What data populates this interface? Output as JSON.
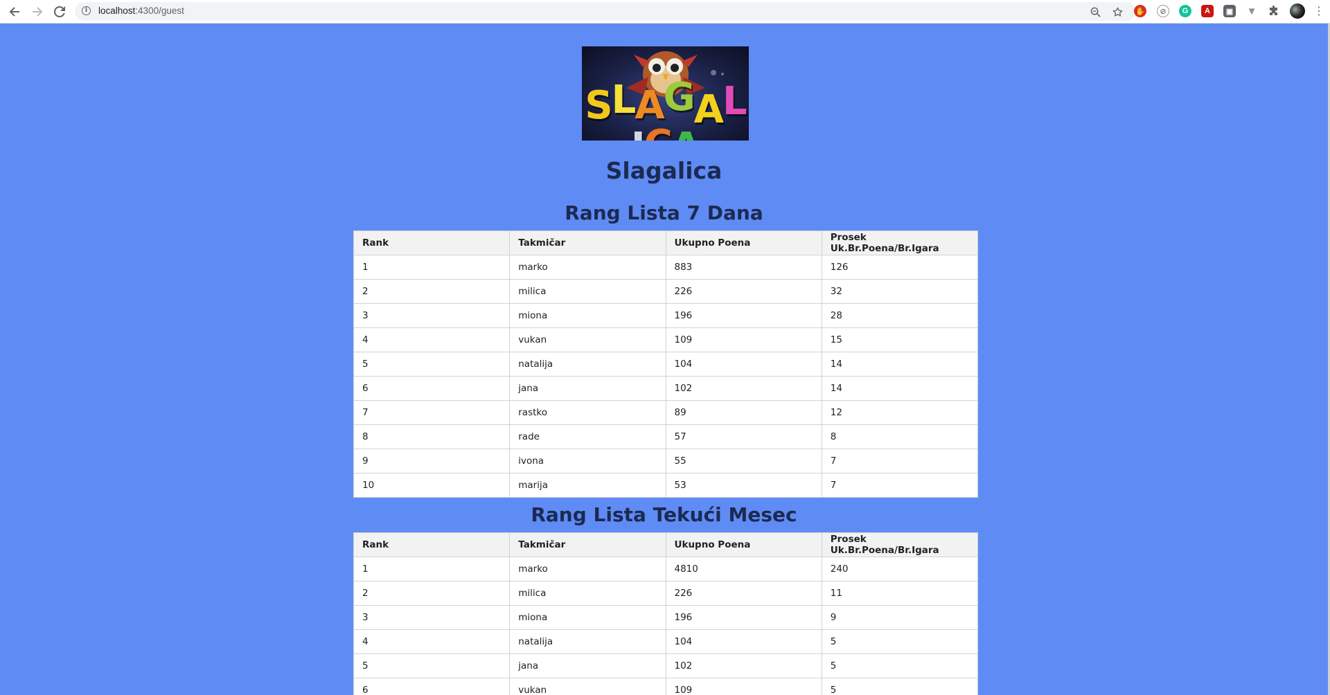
{
  "browser": {
    "url_host": "localhost",
    "url_rest": ":4300/guest",
    "icons": {
      "back": "back-arrow-icon",
      "forward": "forward-arrow-icon",
      "reload": "reload-icon",
      "info": "info-icon",
      "zoom": "zoom-icon",
      "bookmark": "star-icon",
      "extensions": "puzzle-icon",
      "menu": "kebab-menu-icon"
    }
  },
  "page": {
    "background": "#5f8bf5",
    "logo_letters": [
      "S",
      "L",
      "A",
      "G",
      "A",
      "L",
      "I",
      "C",
      "A"
    ],
    "title": "Slagalica"
  },
  "weekly": {
    "heading": "Rang Lista 7 Dana",
    "columns": [
      "Rank",
      "Takmičar",
      "Ukupno Poena",
      "Prosek Uk.Br.Poena/Br.Igara"
    ],
    "rows": [
      [
        "1",
        "marko",
        "883",
        "126"
      ],
      [
        "2",
        "milica",
        "226",
        "32"
      ],
      [
        "3",
        "miona",
        "196",
        "28"
      ],
      [
        "4",
        "vukan",
        "109",
        "15"
      ],
      [
        "5",
        "natalija",
        "104",
        "14"
      ],
      [
        "6",
        "jana",
        "102",
        "14"
      ],
      [
        "7",
        "rastko",
        "89",
        "12"
      ],
      [
        "8",
        "rade",
        "57",
        "8"
      ],
      [
        "9",
        "ivona",
        "55",
        "7"
      ],
      [
        "10",
        "marija",
        "53",
        "7"
      ]
    ]
  },
  "monthly": {
    "heading": "Rang Lista Tekući Mesec",
    "columns": [
      "Rank",
      "Takmičar",
      "Ukupno Poena",
      "Prosek Uk.Br.Poena/Br.Igara"
    ],
    "rows": [
      [
        "1",
        "marko",
        "4810",
        "240"
      ],
      [
        "2",
        "milica",
        "226",
        "11"
      ],
      [
        "3",
        "miona",
        "196",
        "9"
      ],
      [
        "4",
        "natalija",
        "104",
        "5"
      ],
      [
        "5",
        "jana",
        "102",
        "5"
      ],
      [
        "6",
        "vukan",
        "109",
        "5"
      ]
    ]
  }
}
